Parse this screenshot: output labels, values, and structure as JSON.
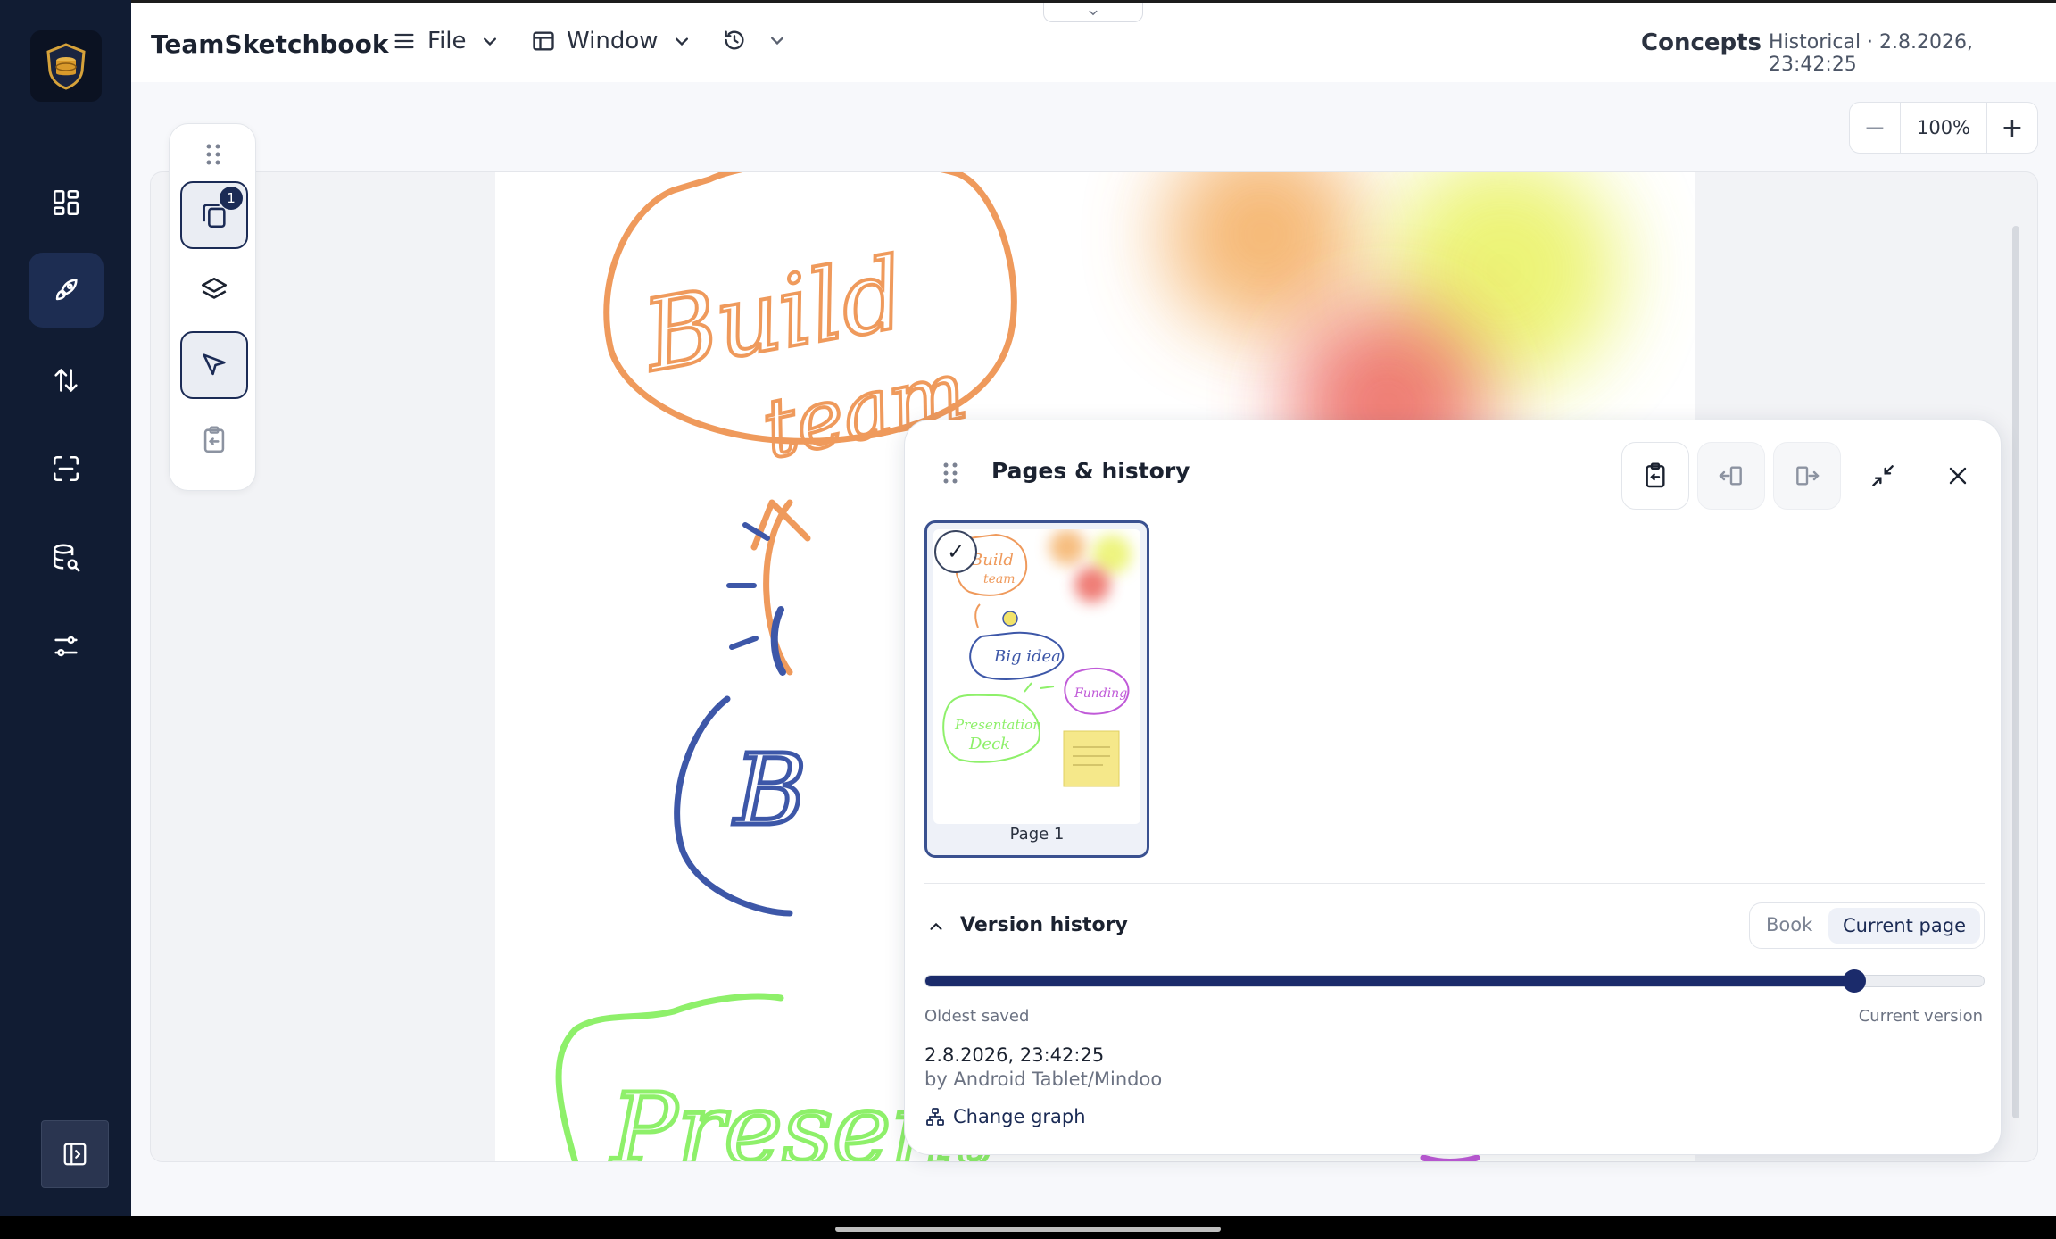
{
  "app": {
    "title": "TeamSketchbook"
  },
  "menus": {
    "file": "File",
    "window": "Window"
  },
  "header": {
    "project": "Concepts",
    "status": "Historical · 2.8.2026, 23:42:25"
  },
  "zoom": {
    "value": "100%",
    "minus": "−",
    "plus": "+"
  },
  "tools": {
    "pages_badge": "1"
  },
  "panel": {
    "title": "Pages & history",
    "page_label": "Page 1",
    "check": "✓",
    "version_history": {
      "title": "Version history",
      "scope_book": "Book",
      "scope_current": "Current page",
      "slider_position": 0.878,
      "oldest_label": "Oldest saved",
      "current_label": "Current version",
      "timestamp": "2.8.2026, 23:42:25",
      "author": "by Android Tablet/Mindoo",
      "change_graph": "Change graph"
    }
  },
  "colors": {
    "rail": "#111c33",
    "accent": "#1b2b6b",
    "sketch_orange": "#ef9a5c",
    "sketch_blue": "#3d57a8",
    "sketch_green": "#8ef06a",
    "sketch_purple": "#c05ad8"
  }
}
